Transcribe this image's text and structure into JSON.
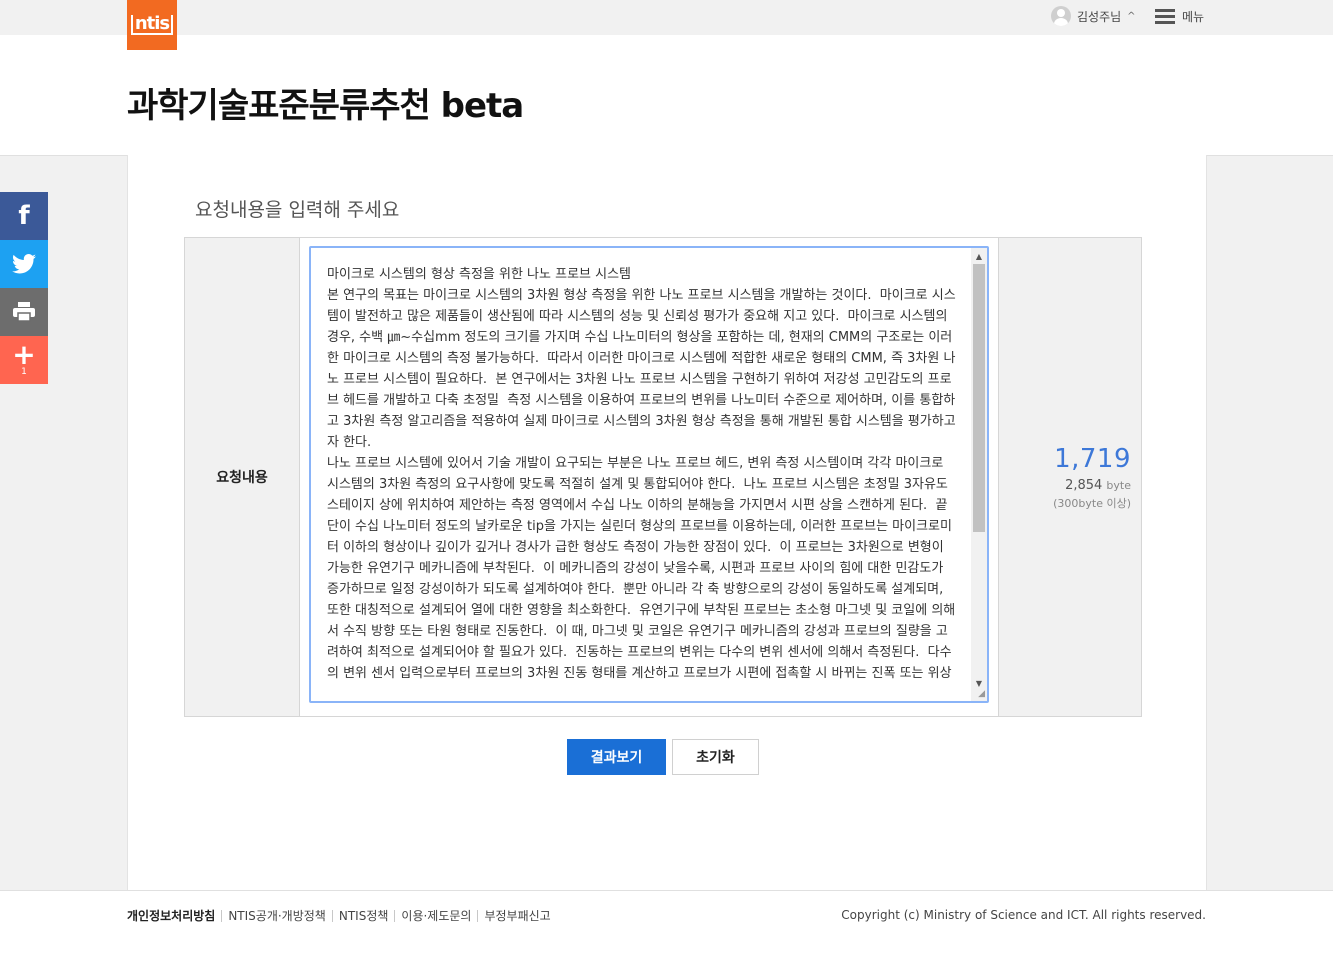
{
  "header": {
    "logo_text": "ntis",
    "user_name": "김성주님",
    "user_caret": "^",
    "menu_label": "메뉴"
  },
  "page_title": "과학기술표준분류추천 beta",
  "form": {
    "prompt": "요청내용을 입력해 주세요",
    "label": "요청내용",
    "text": "마이크로 시스템의 형상 측정을 위한 나노 프로브 시스템\n본 연구의 목표는 마이크로 시스템의 3차원 형상 측정을 위한 나노 프로브 시스템을 개발하는 것이다.  마이크로 시스템이 발전하고 많은 제품들이 생산됨에 따라 시스템의 성능 및 신뢰성 평가가 중요해 지고 있다.  마이크로 시스템의 경우, 수백 ㎛~수십mm 정도의 크기를 가지며 수십 나노미터의 형상을 포함하는 데, 현재의 CMM의 구조로는 이러한 마이크로 시스템의 측정 불가능하다.  따라서 이러한 마이크로 시스템에 적합한 새로운 형태의 CMM, 즉 3차원 나노 프로브 시스템이 필요하다.  본 연구에서는 3차원 나노 프로브 시스템을 구현하기 위하여 저강성 고민감도의 프로브 헤드를 개발하고 다축 초정밀  측정 시스템을 이용하여 프로브의 변위를 나노미터 수준으로 제어하며, 이를 통합하고 3차원 측정 알고리즘을 적용하여 실제 마이크로 시스템의 3차원 형상 측정을 통해 개발된 통합 시스템을 평가하고자 한다.\n나노 프로브 시스템에 있어서 기술 개발이 요구되는 부분은 나노 프로브 헤드, 변위 측정 시스템이며 각각 마이크로 시스템의 3차원 측정의 요구사항에 맞도록 적절히 설계 및 통합되어야 한다.  나노 프로브 시스템은 초정밀 3자유도 스테이지 상에 위치하여 제안하는 측정 영역에서 수십 나노 이하의 분해능을 가지면서 시편 상을 스캔하게 된다.  끝단이 수십 나노미터 정도의 날카로운 tip을 가지는 실린더 형상의 프로브를 이용하는데, 이러한 프로브는 마이크로미터 이하의 형상이나 깊이가 깊거나 경사가 급한 형상도 측정이 가능한 장점이 있다.  이 프로브는 3차원으로 변형이 가능한 유연기구 메카니즘에 부착된다.  이 메카니즘의 강성이 낮을수록, 시편과 프로브 사이의 힘에 대한 민감도가 증가하므로 일정 강성이하가 되도록 설계하여야 한다.  뿐만 아니라 각 축 방향으로의 강성이 동일하도록 설계되며, 또한 대칭적으로 설계되어 열에 대한 영향을 최소화한다.  유연기구에 부착된 프로브는 초소형 마그넷 및 코일에 의해서 수직 방향 또는 타원 형태로 진동한다.  이 때, 마그넷 및 코일은 유연기구 메카니즘의 강성과 프로브의 질량을 고려하여 최적으로 설계되어야 할 필요가 있다.  진동하는 프로브의 변위는 다수의 변위 센서에 의해서 측정된다.  다수의 변위 센서 입력으로부터 프로브의 3차원 진동 형태를 계산하고 프로브가 시편에 접촉할 시 바뀌는 진폭 또는 위상",
    "char_count": "1,719",
    "byte_count": "2,854",
    "byte_unit": "byte",
    "byte_min": "(300byte 이상)"
  },
  "buttons": {
    "submit": "결과보기",
    "reset": "초기화"
  },
  "social": {
    "facebook_icon": "f",
    "twitter_icon": "🐦",
    "print_icon": "🖶",
    "plus_icon": "+",
    "plus_count": "1"
  },
  "footer": {
    "links": [
      "개인정보처리방침",
      "NTIS공개·개방정책",
      "NTIS정책",
      "이용·제도문의",
      "부정부패신고"
    ],
    "copyright": "Copyright (c) Ministry of Science and ICT. All rights reserved."
  },
  "colors": {
    "brand_orange": "#f26a21",
    "primary_blue": "#1a6fd6",
    "count_blue": "#3d78d8",
    "facebook": "#3b5998",
    "twitter": "#1da1f2",
    "print": "#6d6d6d",
    "share_plus": "#ff6550"
  }
}
